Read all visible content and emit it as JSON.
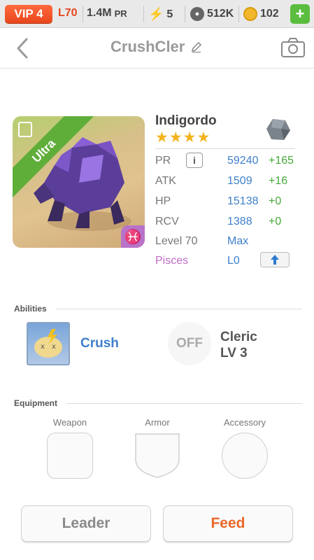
{
  "topbar": {
    "vip": "VIP 4",
    "level": "L70",
    "pr_value": "1.4M",
    "pr_unit": "PR",
    "energy": "5",
    "paws": "512K",
    "coins": "102",
    "plus": "+"
  },
  "header": {
    "title": "CrushCler"
  },
  "monster": {
    "rarity": "Ultra",
    "name": "Indigordo",
    "stars": "★★★★",
    "stats": [
      {
        "label": "PR",
        "value": "59240",
        "bonus": "+165"
      },
      {
        "label": "ATK",
        "value": "1509",
        "bonus": "+16"
      },
      {
        "label": "HP",
        "value": "15138",
        "bonus": "+0"
      },
      {
        "label": "RCV",
        "value": "1388",
        "bonus": "+0"
      },
      {
        "label": "Level 70",
        "value": "Max"
      },
      {
        "label": "Pisces",
        "value": "L0"
      }
    ],
    "info_glyph": "i",
    "pisces_glyph": "♓"
  },
  "abilities": {
    "section_label": "Abilities",
    "primary": "Crush",
    "off_label": "OFF",
    "secondary_name": "Cleric",
    "secondary_level": "LV 3"
  },
  "equipment": {
    "section_label": "Equipment",
    "slots": [
      "Weapon",
      "Armor",
      "Accessory"
    ]
  },
  "actions": {
    "leader": "Leader",
    "feed": "Feed"
  },
  "colors": {
    "vip": "#e8461c",
    "value_blue": "#3e7fc9",
    "bonus_green": "#45a838",
    "pisces": "#c06bc9",
    "feed_orange": "#e8682a",
    "ribbon_green": "#5fae3a"
  }
}
